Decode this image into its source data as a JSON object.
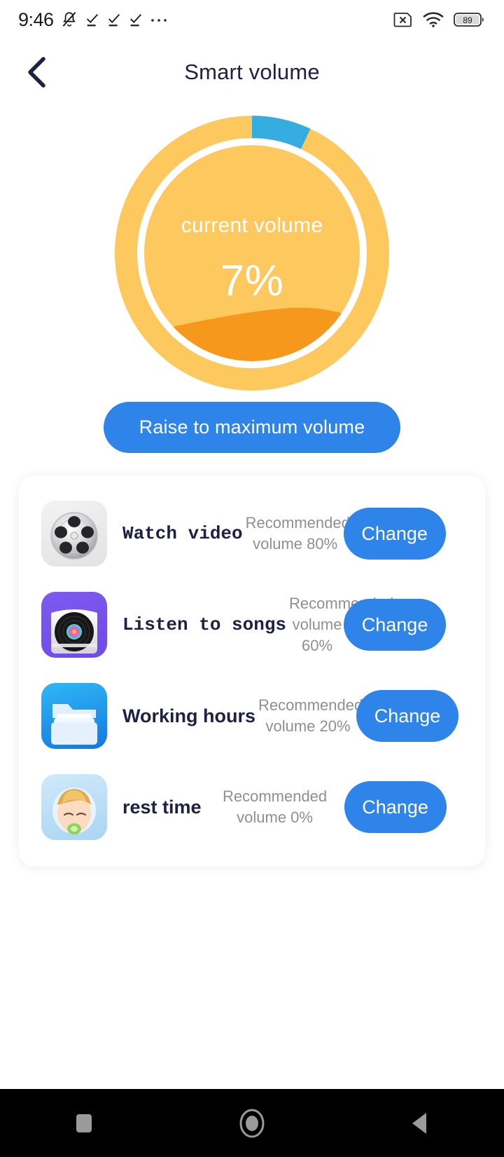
{
  "status_bar": {
    "time": "9:46",
    "battery_level": "89",
    "icons": [
      "bell-muted-icon",
      "check-underline-icon",
      "check-underline-icon",
      "check-underline-icon",
      "overflow-dots-icon",
      "sim-card-off-icon",
      "wifi-icon",
      "battery-icon"
    ]
  },
  "header": {
    "title": "Smart volume",
    "back_icon": "chevron-left-icon"
  },
  "gauge": {
    "label": "current volume",
    "value": "7%",
    "percent": 7,
    "track_color": "#FDC85E",
    "progress_color": "#35ADE0",
    "wave_color": "#F5981C",
    "gap_color": "#FFFFFF"
  },
  "primary_action": {
    "label": "Raise to maximum volume",
    "color": "#2E84E8"
  },
  "scenes": {
    "button_label": "Change",
    "button_color": "#2E84E8",
    "items": [
      {
        "icon": "film-reel-icon",
        "title": "Watch video",
        "recommendation": "Recommended volume 80%",
        "recommended_percent": "80%"
      },
      {
        "icon": "vinyl-record-icon",
        "title": "Listen to songs",
        "recommendation": "Recommended volume 60%",
        "recommended_percent": "60%"
      },
      {
        "icon": "folder-icon",
        "title": "Working hours",
        "recommendation": "Recommended volume 20%",
        "recommended_percent": "20%"
      },
      {
        "icon": "sleeping-baby-icon",
        "title": "rest time",
        "recommendation": "Recommended volume 0%",
        "recommended_percent": "0%"
      }
    ]
  },
  "nav_bar": {
    "recents": "square-recents-icon",
    "home": "circle-home-icon",
    "back": "triangle-back-icon"
  }
}
